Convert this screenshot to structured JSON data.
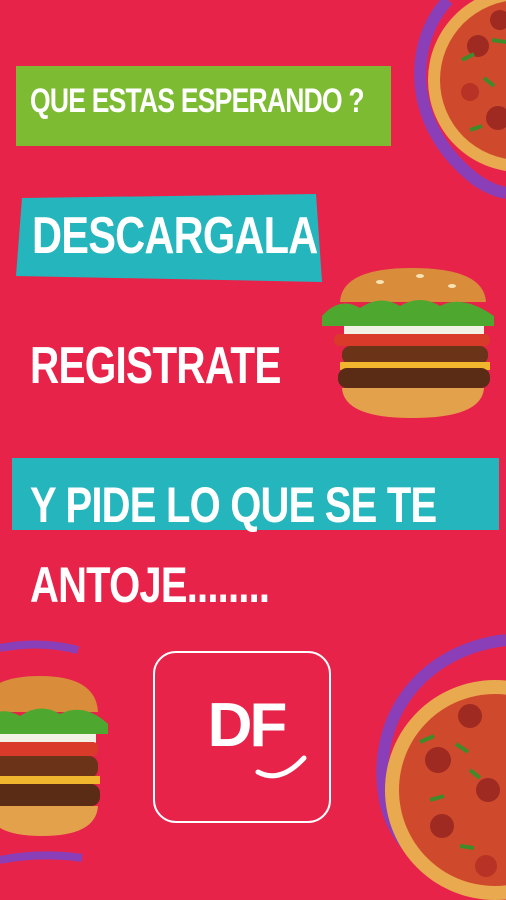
{
  "headlines": {
    "line1": "QUE ESTAS ESPERANDO ?",
    "line2": "DESCARGALA",
    "line3": "REGISTRATE",
    "line4": "Y PIDE LO QUE SE TE",
    "line5": "ANTOJE........"
  },
  "logo": {
    "text": "DF"
  },
  "colors": {
    "background": "#e8234a",
    "green_banner": "#7dbb33",
    "teal_banner": "#25b5bd",
    "purple_accent": "#8a3fb8"
  }
}
